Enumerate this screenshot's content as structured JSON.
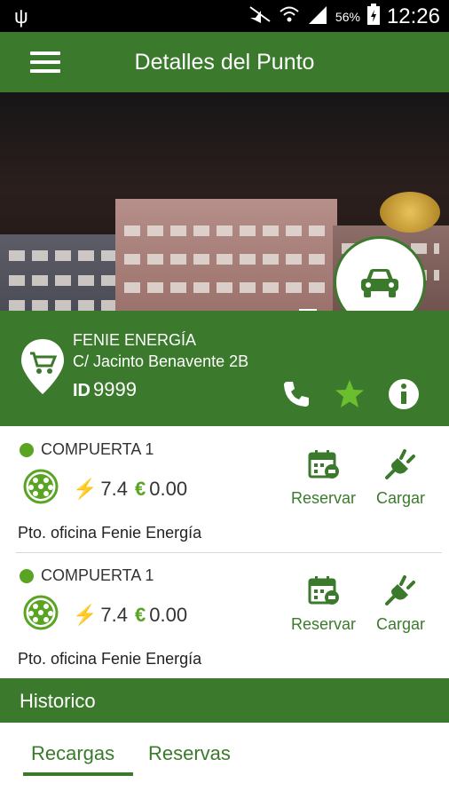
{
  "status_bar": {
    "battery": "56%",
    "time": "12:26"
  },
  "appbar": {
    "title": "Detalles del Punto"
  },
  "point": {
    "name": "FENIE ENERGÍA",
    "address": "C/ Jacinto Benavente 2B",
    "id_label": "ID",
    "id_value": "9999",
    "parking_letter": "P",
    "parking_count": "1"
  },
  "slots": [
    {
      "name": "COMPUERTA 1",
      "power": "7.4",
      "price": "0.00",
      "reserve_label": "Reservar",
      "charge_label": "Cargar",
      "description": "Pto. oficina Fenie Energía"
    },
    {
      "name": "COMPUERTA 1",
      "power": "7.4",
      "price": "0.00",
      "reserve_label": "Reservar",
      "charge_label": "Cargar",
      "description": "Pto. oficina Fenie Energía"
    }
  ],
  "history": {
    "title": "Historico"
  },
  "tabs": [
    {
      "label": "Recargas"
    },
    {
      "label": "Reservas"
    }
  ],
  "colors": {
    "primary": "#3b7a2c",
    "accent": "#5aa423"
  },
  "icons": {
    "power": "⚡",
    "currency": "€"
  }
}
